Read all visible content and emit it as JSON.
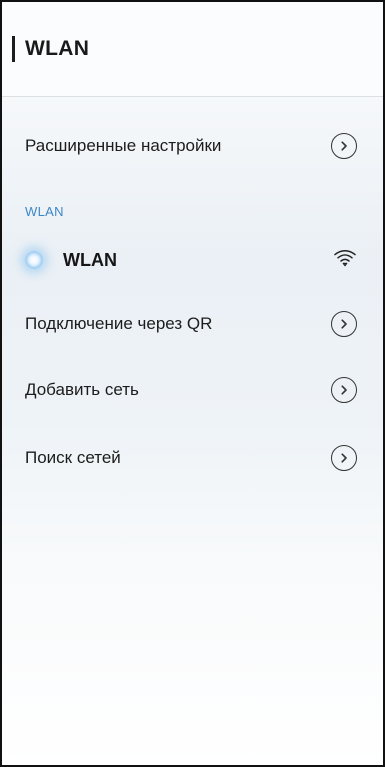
{
  "header": {
    "title": "WLAN"
  },
  "rows": {
    "advanced": {
      "label": "Расширенные настройки",
      "icon": "chevron-circle-right-icon"
    },
    "section_title": "WLAN",
    "wlan_toggle": {
      "label": "WLAN",
      "state": "on",
      "icon": "wifi-icon"
    },
    "qr": {
      "label": "Подключение через QR",
      "icon": "chevron-circle-right-icon"
    },
    "add_network": {
      "label": "Добавить сеть",
      "icon": "chevron-circle-right-icon"
    },
    "search": {
      "label": "Поиск сетей",
      "icon": "chevron-circle-right-icon"
    }
  },
  "colors": {
    "section_accent": "#3c87c5",
    "text": "#1c1c1c",
    "toggle_glow": "#9fcdf1"
  }
}
